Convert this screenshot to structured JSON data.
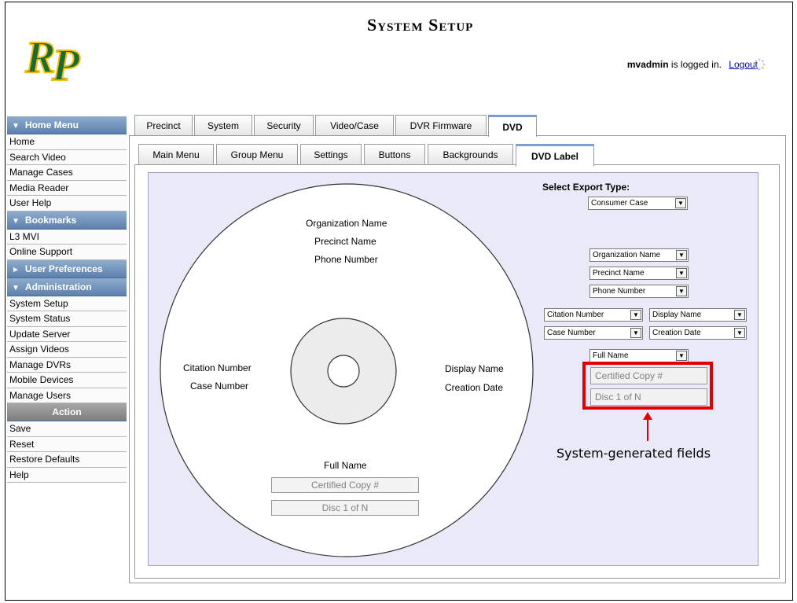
{
  "header": {
    "title": "System Setup",
    "logo_text": "RP",
    "user": "mvadmin",
    "login_suffix": "is logged in.",
    "logout_label": "Logout"
  },
  "sidebar": {
    "sections": [
      {
        "title": "Home Menu",
        "arrow": "▼",
        "items": [
          "Home",
          "Search Video",
          "Manage Cases",
          "Media Reader",
          "User Help"
        ]
      },
      {
        "title": "Bookmarks",
        "arrow": "▼",
        "items": [
          "L3 MVI",
          "Online Support"
        ]
      },
      {
        "title": "User Preferences",
        "arrow": "►",
        "items": []
      },
      {
        "title": "Administration",
        "arrow": "▼",
        "items": [
          "System Setup",
          "System Status",
          "Update Server",
          "Assign Videos",
          "Manage DVRs",
          "Mobile Devices",
          "Manage Users"
        ]
      },
      {
        "title": "Action",
        "arrow": "",
        "items": [
          "Save",
          "Reset",
          "Restore Defaults",
          "Help"
        ]
      }
    ]
  },
  "outer_tabs": [
    "Precinct",
    "System",
    "Security",
    "Video/Case",
    "DVR Firmware",
    "DVD"
  ],
  "outer_active": "DVD",
  "inner_tabs": [
    "Main Menu",
    "Group Menu",
    "Settings",
    "Buttons",
    "Backgrounds",
    "DVD Label"
  ],
  "inner_active": "DVD Label",
  "disc": {
    "org": "Organization Name",
    "precinct": "Precinct Name",
    "phone": "Phone Number",
    "citation": "Citation Number",
    "case": "Case Number",
    "display": "Display Name",
    "creation": "Creation Date",
    "fullname": "Full Name",
    "certified": "Certified Copy #",
    "disc_of": "Disc 1 of N"
  },
  "controls": {
    "export_label": "Select Export Type:",
    "export_value": "Consumer Case",
    "top1": "Organization Name",
    "top2": "Precinct Name",
    "top3": "Phone Number",
    "left1": "Citation Number",
    "left2": "Case Number",
    "right1": "Display Name",
    "right2": "Creation Date",
    "bottom": "Full Name",
    "certified": "Certified Copy #",
    "disc_of": "Disc 1 of N"
  },
  "annotation": {
    "text": "System-generated fields",
    "color": "#e00000"
  }
}
